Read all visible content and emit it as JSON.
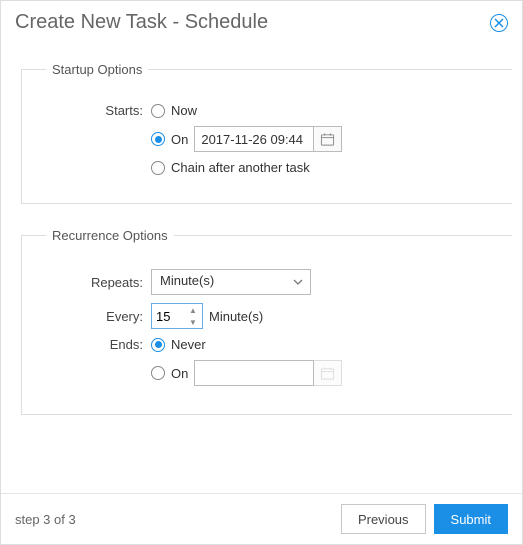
{
  "modal": {
    "title": "Create New Task - Schedule"
  },
  "startup": {
    "legend": "Startup Options",
    "starts_label": "Starts:",
    "options": {
      "now": "Now",
      "on": "On",
      "chain": "Chain after another task"
    },
    "selected": "on",
    "on_date": "2017-11-26 09:44"
  },
  "recurrence": {
    "legend": "Recurrence Options",
    "repeats_label": "Repeats:",
    "repeats_value": "Minute(s)",
    "every_label": "Every:",
    "every_value": "15",
    "every_unit": "Minute(s)",
    "ends_label": "Ends:",
    "ends_options": {
      "never": "Never",
      "on": "On"
    },
    "ends_selected": "never",
    "ends_on_date": ""
  },
  "footer": {
    "step": "step 3 of 3",
    "previous": "Previous",
    "submit": "Submit"
  }
}
